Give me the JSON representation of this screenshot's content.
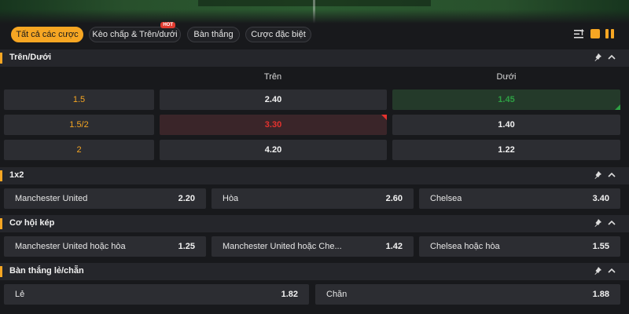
{
  "tabs": [
    {
      "label": "Tất cả các cược",
      "active": true
    },
    {
      "label": "Kèo chấp & Trên/dưới",
      "badge": "HOT"
    },
    {
      "label": "Bàn thắng"
    },
    {
      "label": "Cược đặc biệt"
    }
  ],
  "toolbar": {
    "icons": [
      "sort-icon",
      "square-icon",
      "pause-icon"
    ],
    "accent": "#f6a623"
  },
  "over_under": {
    "title": "Trên/Dưới",
    "col_over": "Trên",
    "col_under": "Dưới",
    "rows": [
      {
        "line": "1.5",
        "over": "2.40",
        "under": "1.45",
        "under_trend": "up"
      },
      {
        "line": "1.5/2",
        "over": "3.30",
        "under": "1.40",
        "over_trend": "down"
      },
      {
        "line": "2",
        "over": "4.20",
        "under": "1.22"
      }
    ]
  },
  "one_x_two": {
    "title": "1x2",
    "picks": [
      {
        "name": "Manchester United",
        "odd": "2.20"
      },
      {
        "name": "Hòa",
        "odd": "2.60"
      },
      {
        "name": "Chelsea",
        "odd": "3.40"
      }
    ]
  },
  "double_chance": {
    "title": "Cơ hội kép",
    "picks": [
      {
        "name": "Manchester United hoặc hòa",
        "odd": "1.25"
      },
      {
        "name": "Manchester United hoặc Che...",
        "odd": "1.42"
      },
      {
        "name": "Chelsea hoặc hòa",
        "odd": "1.55"
      }
    ]
  },
  "odd_even": {
    "title": "Bàn thắng lẻ/chẵn",
    "picks": [
      {
        "name": "Lẻ",
        "odd": "1.82"
      },
      {
        "name": "Chẵn",
        "odd": "1.88"
      }
    ]
  },
  "colors": {
    "up": "#2ea043",
    "down": "#e5322e",
    "accent": "#f6a623"
  }
}
